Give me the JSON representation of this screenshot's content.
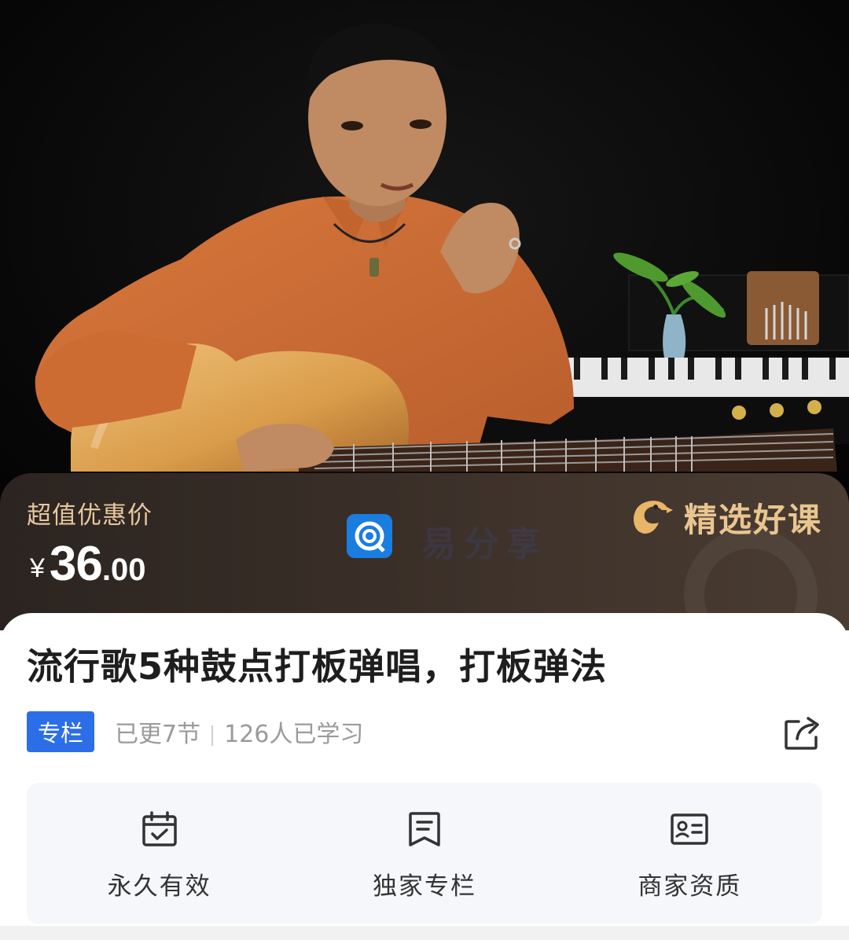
{
  "price_banner": {
    "label": "超值优惠价",
    "currency": "¥",
    "price_integer": "36",
    "price_decimal": ".00",
    "brand_text": "精选好课",
    "watermark_text": "易分享"
  },
  "course": {
    "title": "流行歌5种鼓点打板弹唱，打板弹法",
    "badge": "专栏",
    "updates": "已更7节",
    "learners": "126人已学习"
  },
  "features": [
    {
      "label": "永久有效",
      "icon": "calendar-check-icon"
    },
    {
      "label": "独家专栏",
      "icon": "document-bookmark-icon"
    },
    {
      "label": "商家资质",
      "icon": "id-card-icon"
    }
  ],
  "colors": {
    "badge_blue": "#2b6ee8",
    "price_label_gold": "#e7c79f",
    "brand_gold": "#e9c590",
    "shirt_orange": "#c86a34"
  }
}
